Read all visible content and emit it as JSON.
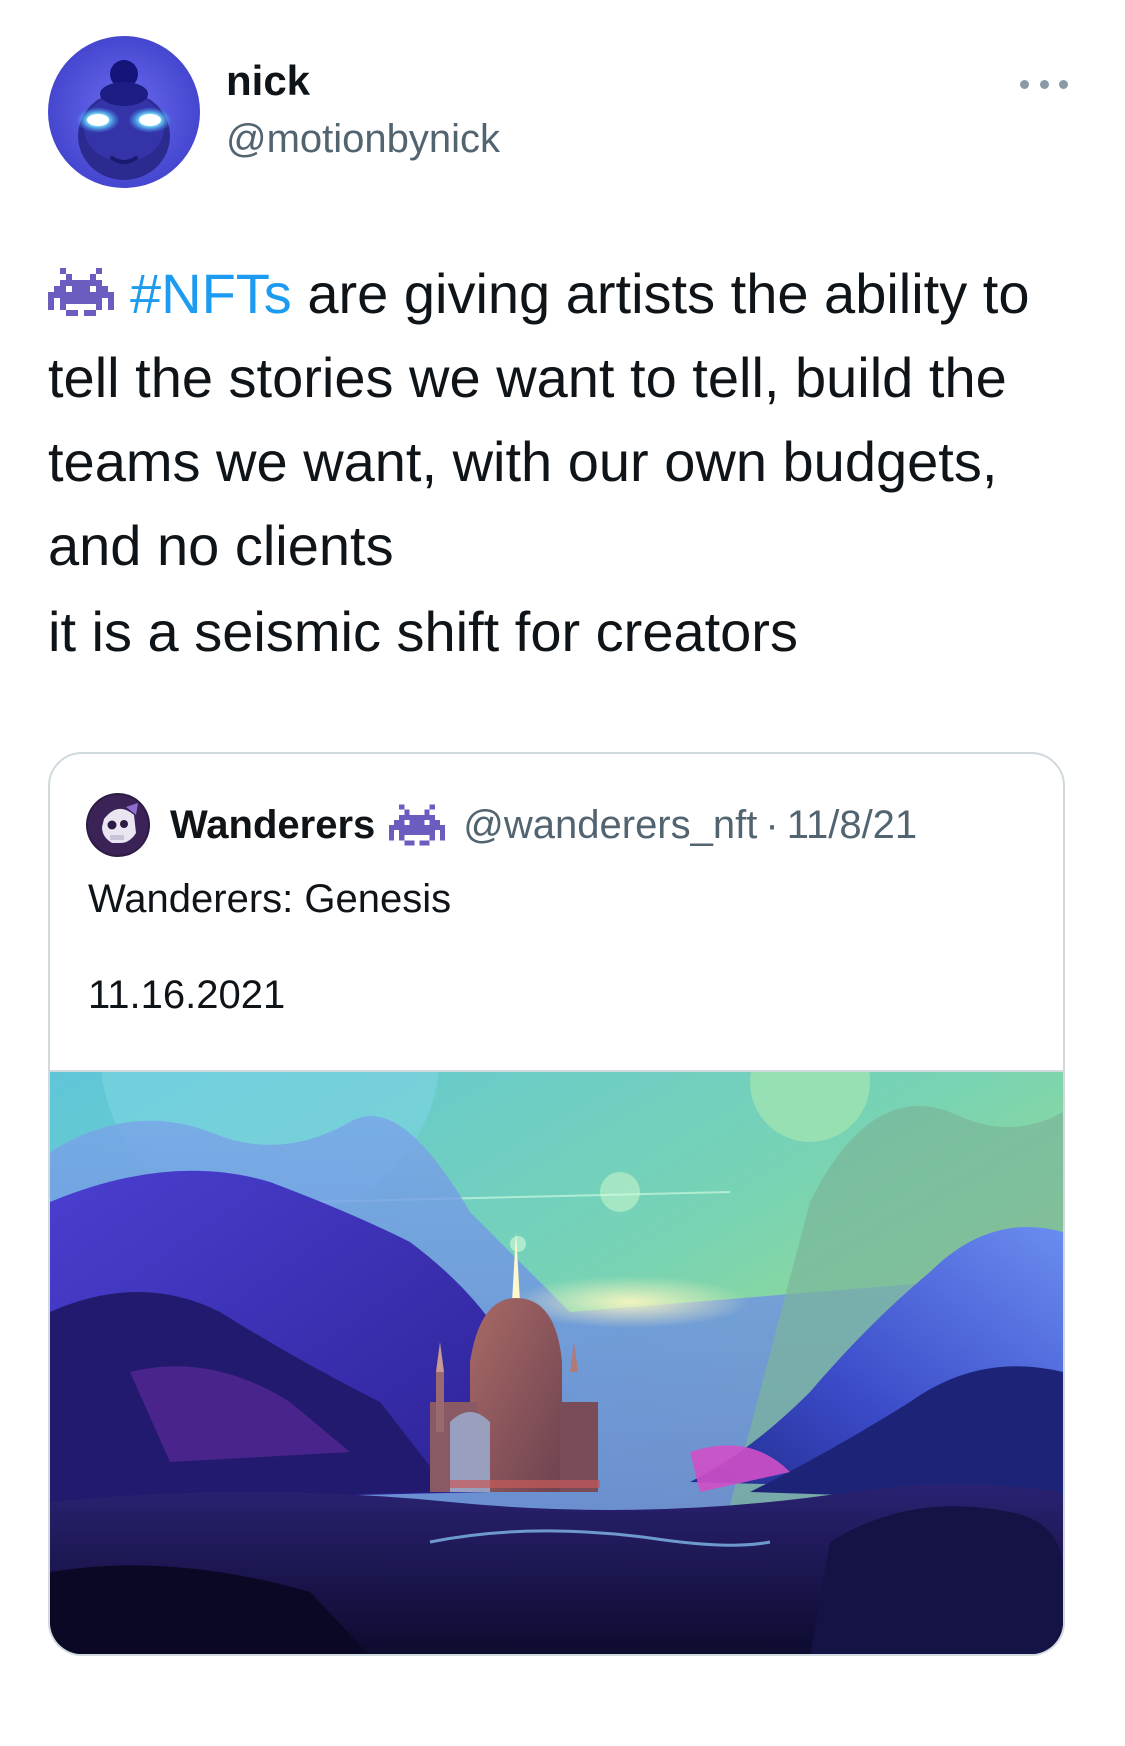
{
  "tweet": {
    "author": {
      "name": "nick",
      "handle": "@motionbynick",
      "avatar_icon": "glowing-eyes-character-avatar"
    },
    "more_icon": "more-dots-icon",
    "text": {
      "emoji_icon": "space-invader-icon",
      "hashtag": "#NFTs",
      "line1_rest": " are giving artists the ability to tell the stories we want to tell, build the teams we want, with our own budgets, and no clients",
      "line2": "it is a seismic shift for creators"
    },
    "colors": {
      "hashtag": "#1d9bf0",
      "secondary_text": "#536471",
      "border": "#cfd9de"
    }
  },
  "quoted_tweet": {
    "author": {
      "name": "Wanderers",
      "name_emoji_icon": "space-invader-icon",
      "handle": "@wanderers_nft",
      "separator": "·",
      "date": "11/8/21",
      "avatar_icon": "skull-helmet-avatar"
    },
    "text": {
      "line1": "Wanderers: Genesis",
      "line2": "11.16.2021"
    },
    "media": {
      "icon": "landscape-illustration-castle-mountains"
    }
  }
}
